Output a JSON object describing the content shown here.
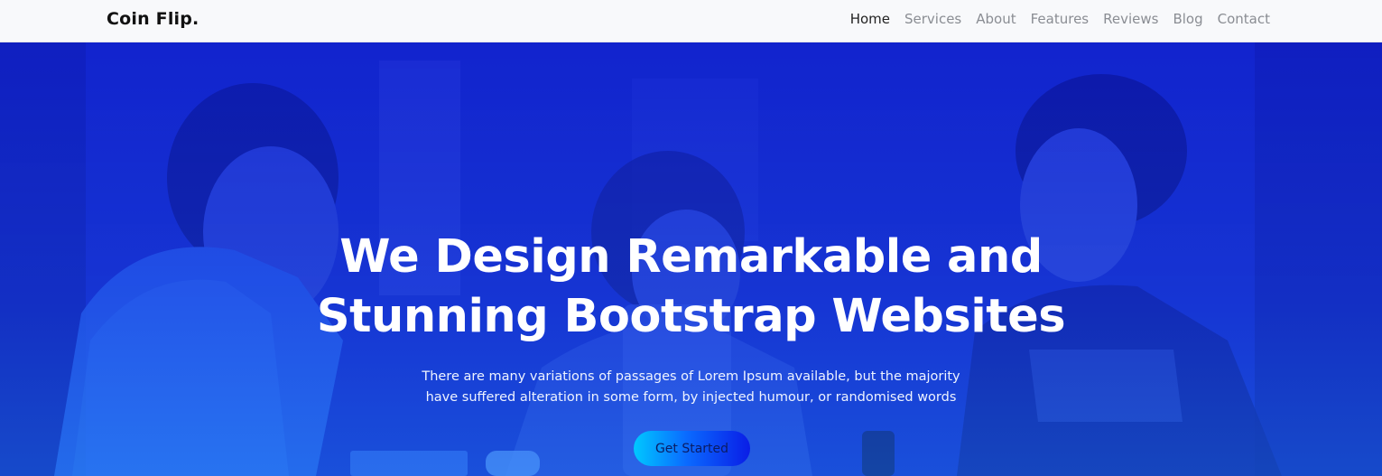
{
  "navbar": {
    "brand": "Coin Flip.",
    "links": [
      "Home",
      "Services",
      "About",
      "Features",
      "Reviews",
      "Blog",
      "Contact"
    ],
    "active_link": "Home"
  },
  "hero": {
    "headline_line1": "We Design Remarkable and",
    "headline_line2": "Stunning Bootstrap Websites",
    "subtext_line1": "There are many variations of passages of Lorem Ipsum available, but the majority",
    "subtext_line2": "have suffered alteration in some form, by injected humour, or randomised words",
    "cta_label": "Get Started"
  },
  "colors": {
    "overlay_top": "#1028c8",
    "overlay_bottom": "#1f62e8",
    "cta_start": "#00c8ff",
    "cta_end": "#0a1de6",
    "nav_bg": "#f8f9fb"
  }
}
